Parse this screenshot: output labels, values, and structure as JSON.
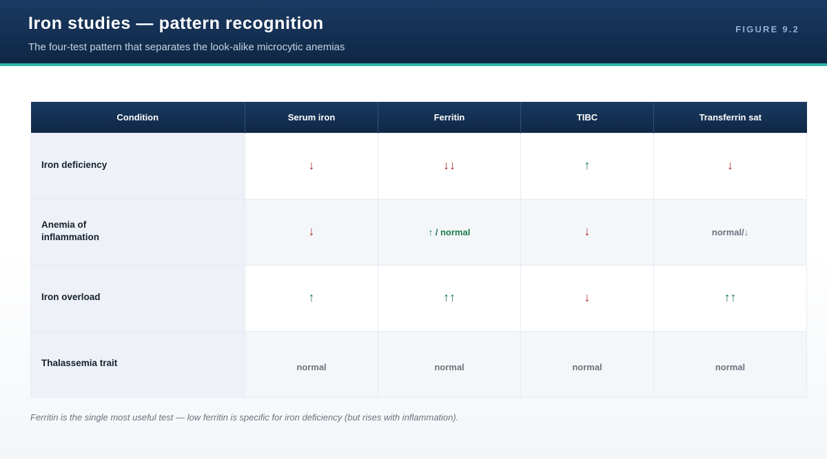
{
  "header": {
    "title": "Iron studies — pattern recognition",
    "subtitle": "The four-test pattern that separates the look-alike microcytic anemias",
    "figure_label": "FIGURE 9.2"
  },
  "table": {
    "columns": [
      "Condition",
      "Serum iron",
      "Ferritin",
      "TIBC",
      "Transferrin sat"
    ],
    "rows": [
      {
        "condition": "Iron deficiency",
        "cells": [
          {
            "text": "↓",
            "tone": "down"
          },
          {
            "text": "↓↓",
            "tone": "down"
          },
          {
            "text": "↑",
            "tone": "up"
          },
          {
            "text": "↓",
            "tone": "down"
          }
        ]
      },
      {
        "condition": "Anemia of inflammation",
        "cells": [
          {
            "text": "↓",
            "tone": "down"
          },
          {
            "text": "↑ / normal",
            "tone": "up"
          },
          {
            "text": "↓",
            "tone": "down"
          },
          {
            "text": "normal/↓",
            "tone": "normal"
          }
        ]
      },
      {
        "condition": "Iron overload",
        "cells": [
          {
            "text": "↑",
            "tone": "up"
          },
          {
            "text": "↑↑",
            "tone": "up"
          },
          {
            "text": "↓",
            "tone": "down"
          },
          {
            "text": "↑↑",
            "tone": "up"
          }
        ]
      },
      {
        "condition": "Thalassemia trait",
        "cells": [
          {
            "text": "normal",
            "tone": "normal"
          },
          {
            "text": "normal",
            "tone": "normal"
          },
          {
            "text": "normal",
            "tone": "normal"
          },
          {
            "text": "normal",
            "tone": "normal"
          }
        ]
      }
    ]
  },
  "footnote": "Ferritin is the single most useful test — low ferritin is specific for iron deficiency (but rises with inflammation).",
  "colors": {
    "header_bg": "#0f2744",
    "accent": "#2bb5a6",
    "down": "#b02828",
    "up": "#1f7a4a",
    "normal": "#6b737d"
  }
}
